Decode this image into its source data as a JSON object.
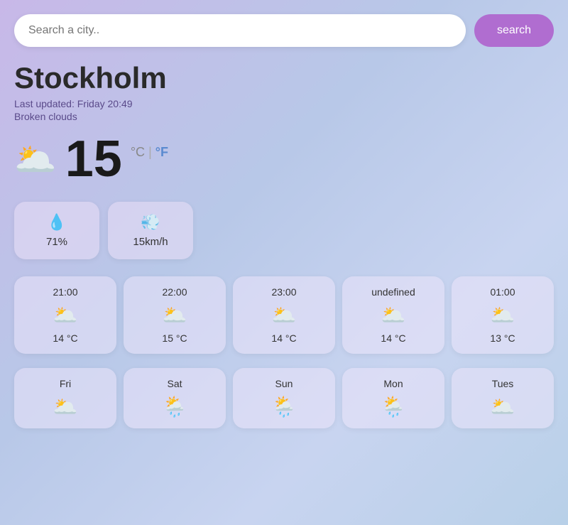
{
  "search": {
    "placeholder": "Search a city..",
    "button_label": "search"
  },
  "city": {
    "name": "Stockholm",
    "last_updated": "Last updated: Friday 20:49",
    "condition": "Broken clouds",
    "temperature": "15",
    "unit_celsius": "°C",
    "unit_separator": " | ",
    "unit_fahrenheit": "°F"
  },
  "stats": [
    {
      "icon": "💧",
      "value": "71%"
    },
    {
      "icon": "💨",
      "value": "15km/h"
    }
  ],
  "hourly": [
    {
      "time": "21:00",
      "icon": "🌥️",
      "temp": "14 °C"
    },
    {
      "time": "22:00",
      "icon": "🌥️",
      "temp": "15 °C"
    },
    {
      "time": "23:00",
      "icon": "🌥️",
      "temp": "14 °C"
    },
    {
      "time": "undefined",
      "icon": "🌥️",
      "temp": "14 °C"
    },
    {
      "time": "01:00",
      "icon": "🌥️",
      "temp": "13 °C"
    }
  ],
  "daily": [
    {
      "day": "Fri",
      "icon": "🌥️"
    },
    {
      "day": "Sat",
      "icon": "🌦️"
    },
    {
      "day": "Sun",
      "icon": "🌦️"
    },
    {
      "day": "Mon",
      "icon": "🌦️"
    },
    {
      "day": "Tues",
      "icon": "🌥️"
    }
  ],
  "main_icon": "🌥️"
}
